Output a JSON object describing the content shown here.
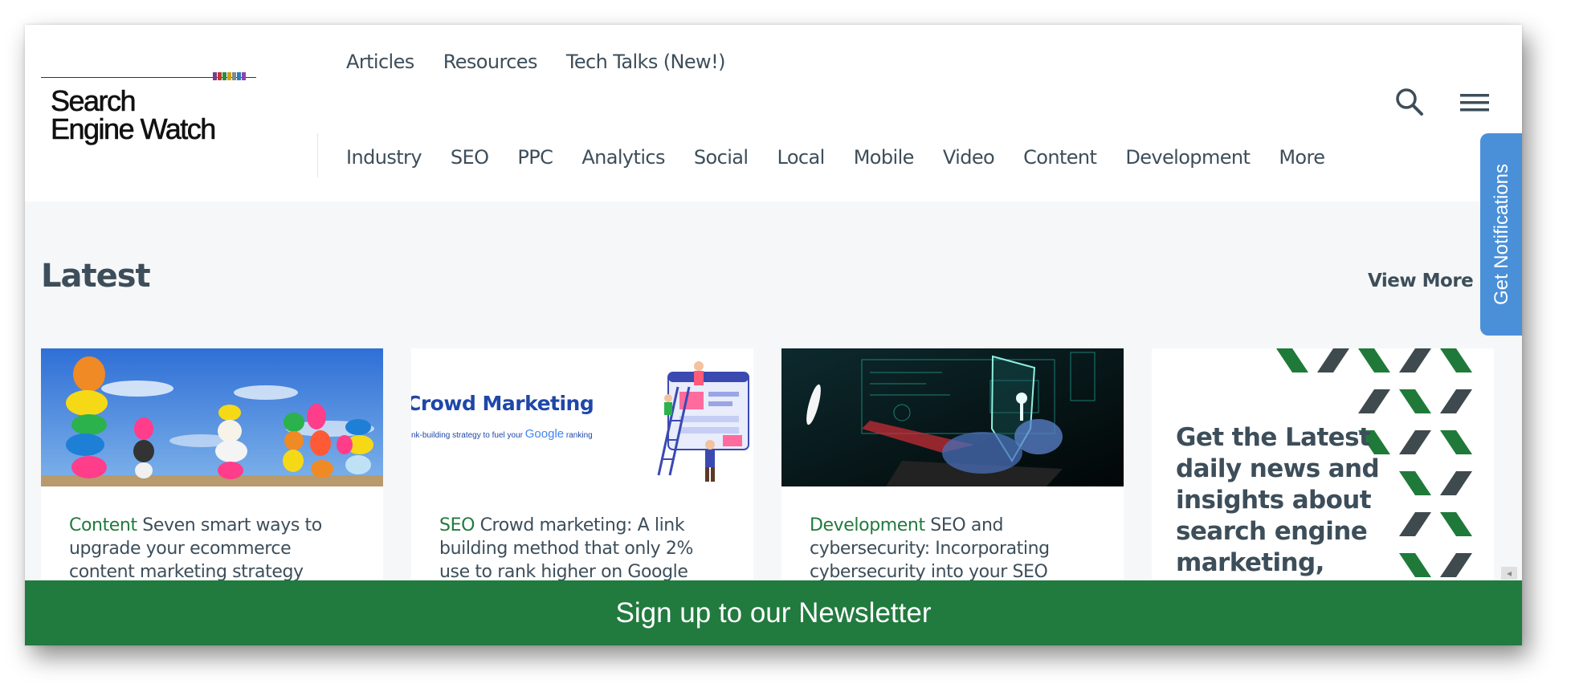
{
  "brand": {
    "logo_line1": "Search",
    "logo_line2": "Engine Watch",
    "bar_colors": [
      "#7b3b8f",
      "#c0392b",
      "#2e8b3d",
      "#d4a017",
      "#7f8c8d",
      "#2980b9",
      "#8e44ad"
    ]
  },
  "top_nav": [
    "Articles",
    "Resources",
    "Tech Talks (New!)"
  ],
  "main_nav": [
    "Industry",
    "SEO",
    "PPC",
    "Analytics",
    "Social",
    "Local",
    "Mobile",
    "Video",
    "Content",
    "Development",
    "More"
  ],
  "icons": {
    "search": "search-icon",
    "menu": "hamburger-menu-icon"
  },
  "notifications_tab": "Get Notifications",
  "latest": {
    "title": "Latest",
    "view_more": "View More",
    "cards": [
      {
        "category": "Content",
        "headline": "Seven smart ways to upgrade your ecommerce content marketing strategy"
      },
      {
        "category": "SEO",
        "headline": "Crowd marketing: A link building method that only 2% use to rank higher on Google"
      },
      {
        "category": "Development",
        "headline": "SEO and cybersecurity: Incorporating cybersecurity into your SEO"
      }
    ],
    "card2_image": {
      "title": "Crowd Marketing",
      "subtitle_pre": "nk-building strategy to fuel your",
      "subtitle_brand": "Google",
      "subtitle_post": "ranking"
    },
    "promo": "Get the Latest daily news and insights about search engine marketing, SEO and paid search"
  },
  "newsletter": "Sign up to our Newsletter",
  "colors": {
    "accent_green": "#217a3e",
    "text_dark": "#3d4e5a",
    "notif_blue": "#4a90d9"
  }
}
